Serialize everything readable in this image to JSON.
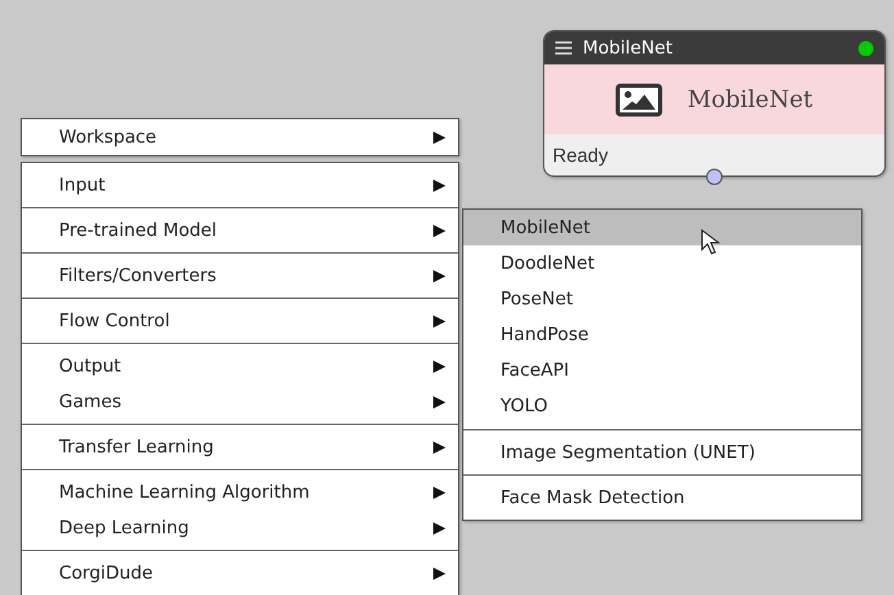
{
  "node": {
    "title": "MobileNet",
    "label": "MobileNet",
    "status": "Ready"
  },
  "workspace_menu": {
    "items": [
      {
        "label": "Workspace",
        "selected": false
      }
    ]
  },
  "main_menu": {
    "groups": [
      {
        "items": [
          {
            "label": "Input",
            "selected": false
          }
        ]
      },
      {
        "items": [
          {
            "label": "Pre-trained Model",
            "selected": false
          }
        ]
      },
      {
        "items": [
          {
            "label": "Filters/Converters",
            "selected": false
          }
        ]
      },
      {
        "items": [
          {
            "label": "Flow Control",
            "selected": false
          }
        ]
      },
      {
        "items": [
          {
            "label": "Output",
            "selected": false
          },
          {
            "label": "Games",
            "selected": false
          }
        ]
      },
      {
        "items": [
          {
            "label": "Transfer Learning",
            "selected": false
          }
        ]
      },
      {
        "items": [
          {
            "label": "Machine Learning Algorithm",
            "selected": false
          },
          {
            "label": "Deep Learning",
            "selected": false
          }
        ]
      },
      {
        "items": [
          {
            "label": "CorgiDude",
            "selected": false
          }
        ]
      }
    ]
  },
  "submenu": {
    "groups": [
      {
        "items": [
          {
            "label": "MobileNet",
            "selected": true
          },
          {
            "label": "DoodleNet",
            "selected": false
          },
          {
            "label": "PoseNet",
            "selected": false
          },
          {
            "label": "HandPose",
            "selected": false
          },
          {
            "label": "FaceAPI",
            "selected": false
          },
          {
            "label": "YOLO",
            "selected": false
          }
        ]
      },
      {
        "items": [
          {
            "label": "Image Segmentation (UNET)",
            "selected": false
          }
        ]
      },
      {
        "items": [
          {
            "label": "Face Mask Detection",
            "selected": false
          }
        ]
      }
    ]
  }
}
